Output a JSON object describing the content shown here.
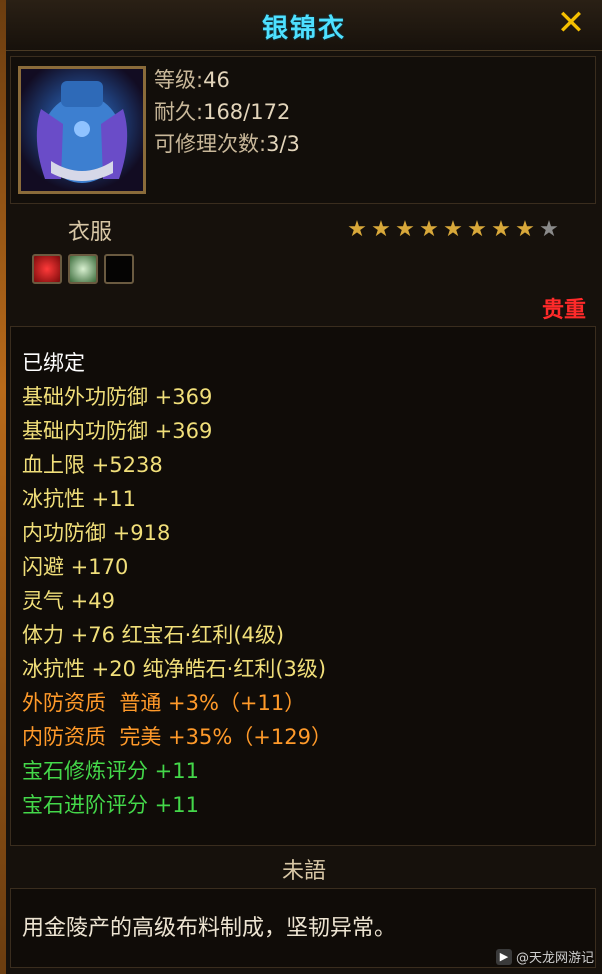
{
  "window": {
    "title": "银锦衣"
  },
  "item": {
    "level_label": "等级:",
    "level_value": "46",
    "durability_label": "耐久:",
    "durability_value": "168/172",
    "repair_label": "可修理次数:",
    "repair_value": "3/3",
    "category": "衣服",
    "stars_filled": 8,
    "stars_total": 9,
    "rarity": "贵重"
  },
  "sockets": [
    {
      "icon": "red-gem-icon"
    },
    {
      "icon": "green-gem-icon"
    },
    {
      "icon": "empty-socket-icon"
    }
  ],
  "attributes": [
    {
      "text": "已绑定",
      "color": "#ffffff"
    },
    {
      "text": "基础外功防御 +369",
      "color": "#f1df7a"
    },
    {
      "text": "基础内功防御 +369",
      "color": "#f1df7a"
    },
    {
      "text": "血上限 +5238",
      "color": "#f1df7a"
    },
    {
      "text": "冰抗性 +11",
      "color": "#f1df7a"
    },
    {
      "text": "内功防御 +918",
      "color": "#f1df7a"
    },
    {
      "text": "闪避 +170",
      "color": "#f1df7a"
    },
    {
      "text": "灵气 +49",
      "color": "#f1df7a"
    },
    {
      "text": "体力 +76 红宝石·红利(4级)",
      "color": "#f1df7a"
    },
    {
      "text": "冰抗性 +20 纯净皓石·红利(3级)",
      "color": "#f1df7a"
    },
    {
      "text": "外防资质  普通 +3%（+11）",
      "color": "#ff9a2a"
    },
    {
      "text": "内防资质  完美 +35%（+129）",
      "color": "#ff9a2a"
    },
    {
      "text": "宝石修炼评分 +11",
      "color": "#44d84a"
    },
    {
      "text": "宝石进阶评分 +11",
      "color": "#44d84a"
    }
  ],
  "description": {
    "header": "未語",
    "text": "用金陵产的高级布料制成，坚韧异常。"
  },
  "watermark": "@天龙网游记"
}
